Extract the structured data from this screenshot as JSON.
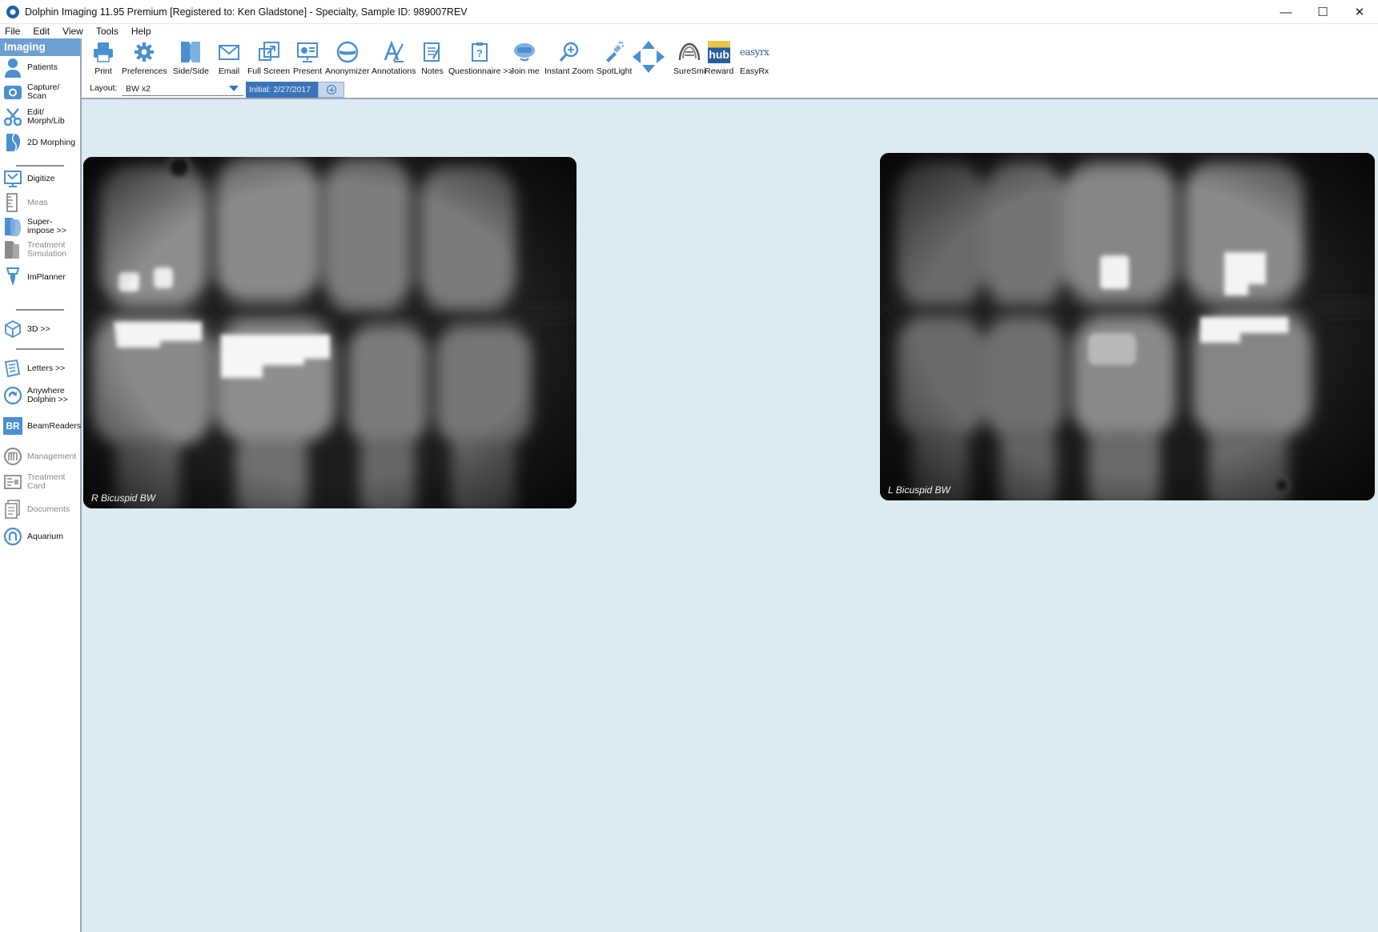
{
  "window": {
    "title": "Dolphin Imaging 11.95 Premium [Registered to: Ken Gladstone] - Specialty, Sample  ID: 989007REV",
    "controls": {
      "minimize": "—",
      "maximize": "☐",
      "close": "✕"
    }
  },
  "menu": {
    "items": [
      "File",
      "Edit",
      "View",
      "Tools",
      "Help"
    ]
  },
  "sidebar": {
    "header": "Imaging",
    "items": [
      {
        "label": "Patients",
        "icon": "patient-icon"
      },
      {
        "label": "Capture/\nScan",
        "icon": "capture-icon"
      },
      {
        "label": "Edit/\nMorph/Lib",
        "icon": "scissors-icon"
      },
      {
        "label": "2D Morphing",
        "icon": "morph-face-icon"
      },
      {
        "label": "Digitize",
        "icon": "digitize-icon"
      },
      {
        "label": "Meas",
        "icon": "ruler-icon",
        "disabled": true
      },
      {
        "label": "Super-\nimpose >>",
        "icon": "superimpose-icon"
      },
      {
        "label": "Treatment\nSimulation",
        "icon": "treatment-simulation-icon",
        "disabled": true
      },
      {
        "label": "ImPlanner",
        "icon": "implant-icon"
      },
      {
        "label": "3D >>",
        "icon": "cube-icon"
      },
      {
        "label": "Letters >>",
        "icon": "letters-icon"
      },
      {
        "label": "Anywhere\nDolphin >>",
        "icon": "anywhere-icon"
      },
      {
        "label": "BeamReaders",
        "icon": "beamreaders-icon",
        "badge": "BR"
      },
      {
        "label": "Management",
        "icon": "management-icon",
        "disabled": true
      },
      {
        "label": "Treatment\nCard",
        "icon": "treatment-card-icon",
        "disabled": true
      },
      {
        "label": "Documents",
        "icon": "documents-icon",
        "disabled": true
      },
      {
        "label": "Aquarium",
        "icon": "aquarium-icon"
      }
    ]
  },
  "toolbar": {
    "tools": [
      {
        "label": "Print",
        "icon": "printer-icon"
      },
      {
        "label": "Preferences",
        "icon": "gear-icon"
      },
      {
        "label": "Side/Side",
        "icon": "side-by-side-icon"
      },
      {
        "label": "Email",
        "icon": "email-icon"
      },
      {
        "label": "Full Screen",
        "icon": "full-screen-icon"
      },
      {
        "label": "Present",
        "icon": "present-icon"
      },
      {
        "label": "Anonymizer",
        "icon": "anonymizer-icon"
      },
      {
        "label": "Annotations",
        "icon": "annotations-icon"
      },
      {
        "label": "Notes",
        "icon": "notes-icon"
      },
      {
        "label": "Questionnaire >>",
        "icon": "questionnaire-icon"
      },
      {
        "label": "Join me",
        "icon": "join-me-icon"
      },
      {
        "label": "Instant Zoom",
        "icon": "zoom-icon"
      },
      {
        "label": "SpotLight",
        "icon": "flashlight-icon"
      },
      {
        "label": "",
        "icon": "pan-arrows-icon"
      },
      {
        "label": "SureSmi",
        "icon": "suresmile-icon"
      },
      {
        "label": "Reward",
        "icon": "hub-icon",
        "badge": "hub"
      },
      {
        "label": "EasyRx",
        "icon": "easyrx-icon",
        "badge": "easyrx"
      }
    ]
  },
  "layout_bar": {
    "label": "Layout:",
    "selected": "BW x2",
    "tab": "Initial: 2/27/2017"
  },
  "images": [
    {
      "label": "R Bicuspid BW"
    },
    {
      "label": "L Bicuspid BW"
    }
  ],
  "colors": {
    "accent": "#6d9fd1",
    "icon_blue": "#4a8fd1",
    "tab_active": "#3b73b9",
    "workspace": "#dceaf4"
  }
}
